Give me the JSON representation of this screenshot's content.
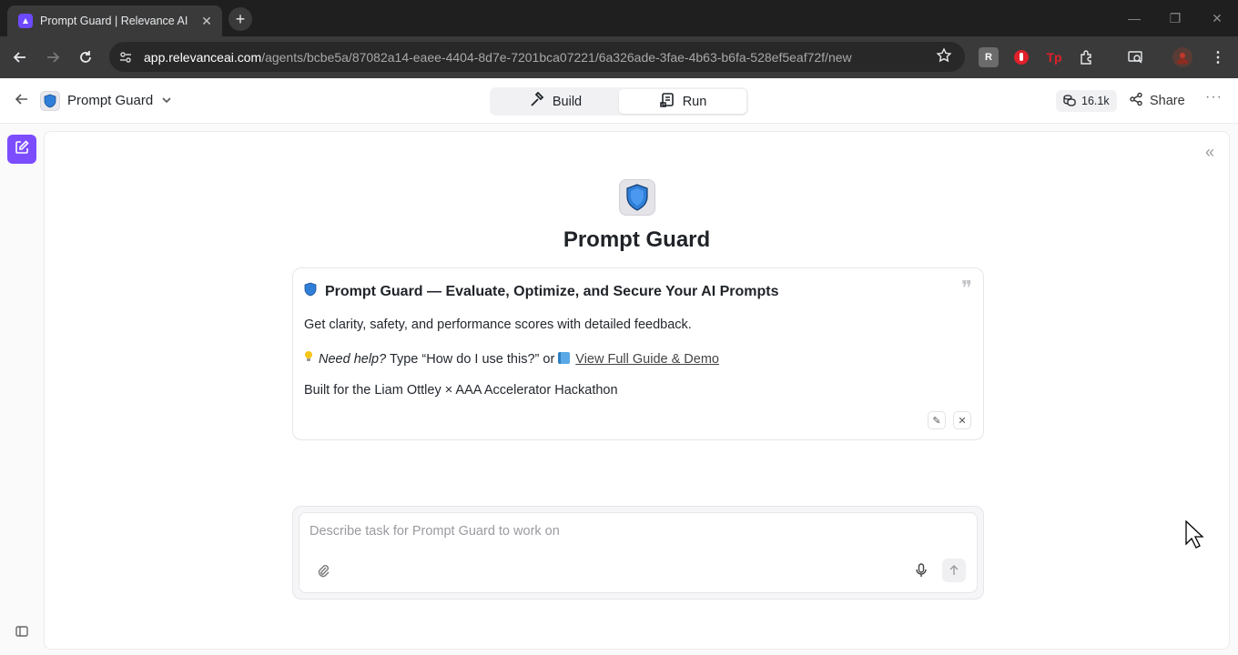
{
  "browser": {
    "tab_title": "Prompt Guard | Relevance AI",
    "url_host": "app.relevanceai.com",
    "url_path": "/agents/bcbe5a/87082a14-eaee-4404-8d7e-7201bca07221/6a326ade-3fae-4b63-b6fa-528ef5eaf72f/new",
    "extensions": [
      {
        "name": "relevance-extension-icon",
        "label": ""
      },
      {
        "name": "red-hand-extension-icon",
        "label": ""
      },
      {
        "name": "tp-extension-icon",
        "label": "Tp"
      }
    ]
  },
  "header": {
    "agent_name": "Prompt Guard",
    "tabs": [
      {
        "label": "Build",
        "icon": "hammer-icon",
        "active": false
      },
      {
        "label": "Run",
        "icon": "run-document-icon",
        "active": true
      }
    ],
    "credits": "16.1k",
    "share_label": "Share"
  },
  "agent": {
    "title": "Prompt Guard",
    "intro": {
      "heading": "Prompt Guard — Evaluate, Optimize, and Secure Your AI Prompts",
      "line1": "Get clarity, safety, and performance scores with detailed feedback.",
      "help_em": "Need help?",
      "help_text": " Type “How do I use this?” or ",
      "guide_link": "View Full Guide & Demo",
      "line3": "Built for the Liam Ottley × AAA Accelerator Hackathon"
    }
  },
  "composer": {
    "placeholder": "Describe task for Prompt Guard to work on",
    "value": ""
  },
  "colors": {
    "accent": "#7c4dff",
    "shield": "#2f7fd8"
  }
}
